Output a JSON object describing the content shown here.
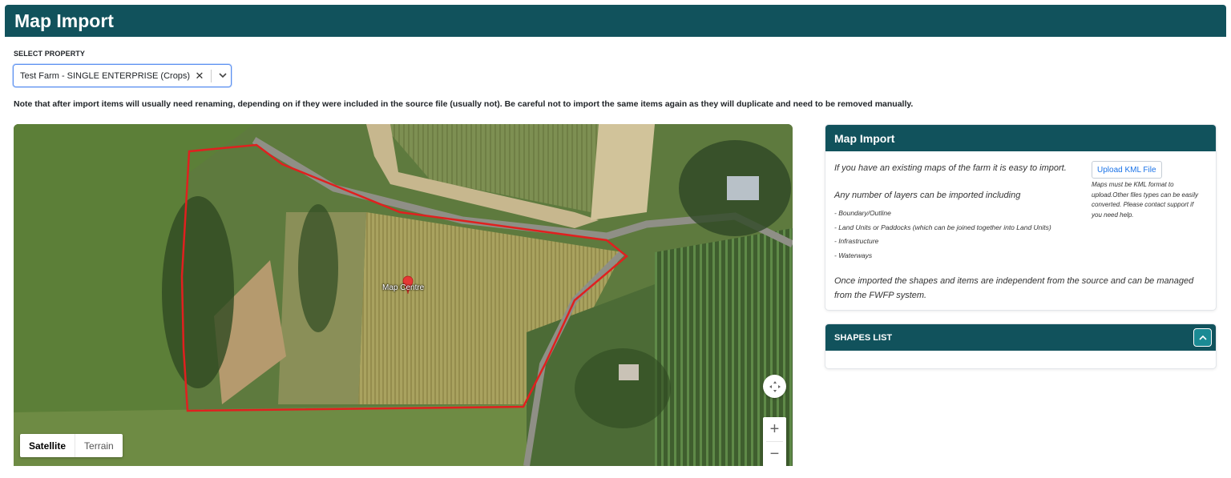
{
  "page": {
    "title": "Map Import"
  },
  "property_select": {
    "label": "SELECT PROPERTY",
    "value": "Test Farm - SINGLE ENTERPRISE (Crops)",
    "clear_symbol": "✕"
  },
  "note": "Note that after import items will usually need renaming, depending on if they were included in the source file (usually not). Be careful not to import the same items again as they will duplicate and need to be removed manually.",
  "map": {
    "marker_label": "Map Centre",
    "map_types": [
      {
        "label": "Satellite",
        "active": true
      },
      {
        "label": "Terrain",
        "active": false
      }
    ],
    "zoom_in": "+",
    "zoom_out": "−",
    "boundary_color": "#e0201f"
  },
  "import_panel": {
    "title": "Map Import",
    "intro": "If you have an existing maps of the farm it is easy to import.",
    "any_layers": "Any number of layers can be imported including",
    "layers": [
      "- Boundary/Outline",
      "- Land Units or Paddocks (which can be joined together into Land Units)",
      "- Infrastructure",
      "- Waterways"
    ],
    "outro": "Once imported the shapes and items are independent from the source and can be managed from the FWFP system.",
    "upload_button": "Upload KML File",
    "kml_note": "Maps must be KML format to upload.Other files types can be easily converted. Please contact support if you need help."
  },
  "shapes_panel": {
    "title": "SHAPES LIST"
  },
  "colors": {
    "header": "#11525c",
    "accent_button": "#1b8a94",
    "link": "#1a73e8"
  }
}
